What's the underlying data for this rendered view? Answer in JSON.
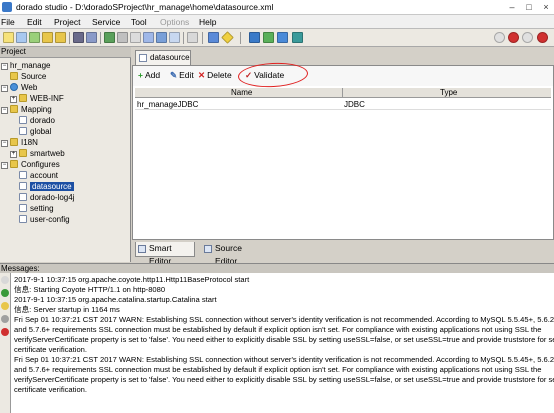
{
  "window": {
    "title": "dorado studio - D:\\doradoSProject\\hr_manage\\home\\datasource.xml",
    "controls": [
      "–",
      "□",
      "×"
    ]
  },
  "menu": [
    {
      "label": "File",
      "disabled": false
    },
    {
      "label": "Edit",
      "disabled": false
    },
    {
      "label": "Project",
      "disabled": false
    },
    {
      "label": "Service",
      "disabled": false
    },
    {
      "label": "Tool",
      "disabled": false
    },
    {
      "label": "Options",
      "disabled": true
    },
    {
      "label": "Help",
      "disabled": false
    }
  ],
  "toolbar": {
    "icons": [
      "new-icon",
      "open-icon",
      "folder-icon",
      "save-icon",
      "save-all-icon",
      "undo-icon",
      "redo-icon",
      "cut-icon",
      "copy-icon",
      "paste-icon",
      "find-icon",
      "window-icon",
      "run-icon",
      "debug-icon",
      "deploy-icon",
      "help-icon",
      "stop-icon",
      "refresh-icon"
    ]
  },
  "project_panel": {
    "title": "Project",
    "tree": [
      {
        "label": "hr_manage",
        "icon": "project-icon",
        "depth": 0,
        "toggle": "−"
      },
      {
        "label": "Source",
        "icon": "source-icon",
        "depth": 1,
        "toggle": ""
      },
      {
        "label": "Web",
        "icon": "web-icon",
        "depth": 0,
        "toggle": "−"
      },
      {
        "label": "WEB-INF",
        "icon": "folder-icon",
        "depth": 1,
        "toggle": "+"
      },
      {
        "label": "Mapping",
        "icon": "folder-icon",
        "depth": 0,
        "toggle": "−"
      },
      {
        "label": "dorado",
        "icon": "mapping-icon",
        "depth": 1,
        "toggle": ""
      },
      {
        "label": "global",
        "icon": "mapping-icon",
        "depth": 1,
        "toggle": ""
      },
      {
        "label": "I18N",
        "icon": "folder-icon",
        "depth": 0,
        "toggle": "−"
      },
      {
        "label": "smartweb",
        "icon": "folder-icon",
        "depth": 1,
        "toggle": "+"
      },
      {
        "label": "Configures",
        "icon": "folder-icon",
        "depth": 0,
        "toggle": "−"
      },
      {
        "label": "account",
        "icon": "file-icon",
        "depth": 1,
        "toggle": ""
      },
      {
        "label": "datasource",
        "icon": "file-icon",
        "depth": 1,
        "toggle": "",
        "selected": true
      },
      {
        "label": "dorado-log4j",
        "icon": "file-icon",
        "depth": 1,
        "toggle": ""
      },
      {
        "label": "setting",
        "icon": "file-icon",
        "depth": 1,
        "toggle": ""
      },
      {
        "label": "user-config",
        "icon": "file-icon",
        "depth": 1,
        "toggle": ""
      }
    ]
  },
  "editor": {
    "tab_label": "datasource",
    "actions": {
      "add": "Add",
      "edit": "Edit",
      "delete": "Delete",
      "validate": "Validate"
    },
    "columns": [
      "Name",
      "Type"
    ],
    "rows": [
      {
        "name": "hr_manageJDBC",
        "type": "JDBC"
      }
    ],
    "bottom_tabs": {
      "smart": "Smart Editor",
      "source": "Source Editor"
    },
    "annotation_color": "#e02020"
  },
  "messages": {
    "title": "Messages:",
    "lines": [
      "2017-9-1 10:37:15 org.apache.coyote.http11.Http11BaseProtocol start",
      "信息: Starting Coyote HTTP/1.1 on http-8080",
      "2017-9-1 10:37:15 org.apache.catalina.startup.Catalina start",
      "信息: Server startup in 1164 ms",
      "Fri Sep 01 10:37:21 CST 2017 WARN: Establishing SSL connection without server's identity verification is not recommended. According to MySQL 5.5.45+, 5.6.26+",
      "and 5.7.6+ requirements SSL connection must be established by default if explicit option isn't set. For compliance with existing applications not using SSL the",
      "verifyServerCertificate property is set to 'false'. You need either to explicitly disable SSL by setting useSSL=false, or set useSSL=true and provide truststore for server",
      "certificate verification.",
      "Fri Sep 01 10:37:21 CST 2017 WARN: Establishing SSL connection without server's identity verification is not recommended. According to MySQL 5.5.45+, 5.6.26+",
      "and 5.7.6+ requirements SSL connection must be established by default if explicit option isn't set. For compliance with existing applications not using SSL the",
      "verifyServerCertificate property is set to 'false'. You need either to explicitly disable SSL by setting useSSL=false, or set useSSL=true and provide truststore for server",
      "certificate verification."
    ]
  }
}
